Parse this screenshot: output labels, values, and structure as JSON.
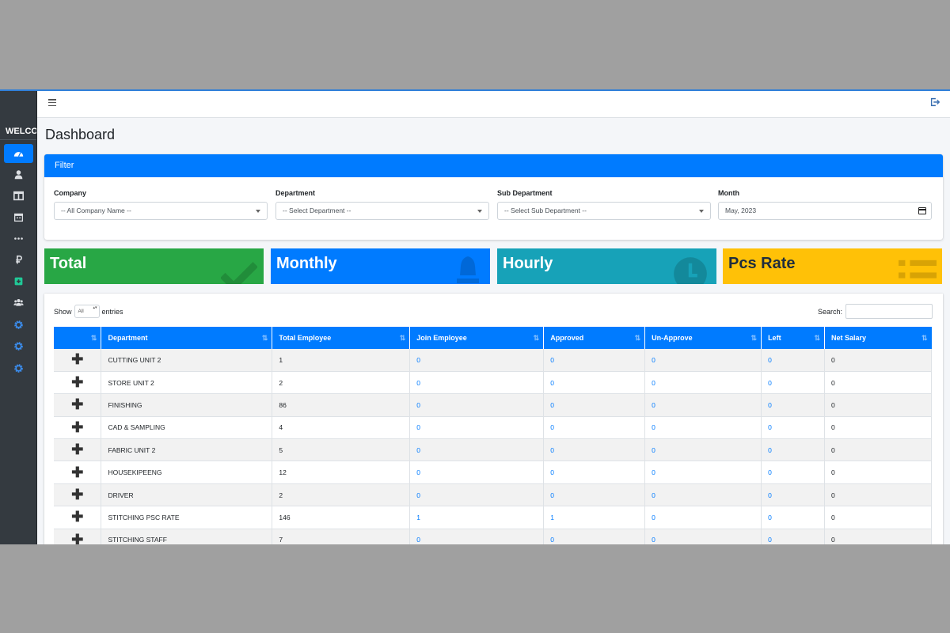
{
  "sidebar": {
    "welcome": "WELCOME",
    "icons": [
      "tachometer-icon",
      "user-icon",
      "columns-icon",
      "calendar-icon",
      "ellipsis-icon",
      "ruble-icon",
      "plus-square-icon",
      "users-icon",
      "cog-icon",
      "cog-icon",
      "cog-icon"
    ]
  },
  "page": {
    "title": "Dashboard"
  },
  "filter": {
    "header": "Filter",
    "company": {
      "label": "Company",
      "value": "-- All Company Name --"
    },
    "department": {
      "label": "Department",
      "value": "-- Select Department --"
    },
    "sub_department": {
      "label": "Sub Department",
      "value": "-- Select Sub Department --"
    },
    "month": {
      "label": "Month",
      "value": "May, 2023"
    }
  },
  "stats": [
    {
      "label": "Total",
      "color": "#28a745",
      "icon": "check-icon"
    },
    {
      "label": "Monthly",
      "color": "#007bff",
      "icon": "bell-icon"
    },
    {
      "label": "Hourly",
      "color": "#17a2b8",
      "icon": "clock-icon"
    },
    {
      "label": "Pcs Rate",
      "color": "#ffc107",
      "icon": "list-icon"
    }
  ],
  "table": {
    "show_label": "Show",
    "entries_value": "All",
    "entries_label": "entries",
    "search_label": "Search:",
    "columns": [
      "",
      "Department",
      "Total Employee",
      "Join Employee",
      "Approved",
      "Un-Approve",
      "Left",
      "Net Salary"
    ],
    "rows": [
      [
        "CUTTING UNIT 2",
        "1",
        "0",
        "0",
        "0",
        "0",
        "0"
      ],
      [
        "STORE UNIT 2",
        "2",
        "0",
        "0",
        "0",
        "0",
        "0"
      ],
      [
        "FINISHING",
        "86",
        "0",
        "0",
        "0",
        "0",
        "0"
      ],
      [
        "CAD & SAMPLING",
        "4",
        "0",
        "0",
        "0",
        "0",
        "0"
      ],
      [
        "FABRIC UNIT 2",
        "5",
        "0",
        "0",
        "0",
        "0",
        "0"
      ],
      [
        "HOUSEKIPEENG",
        "12",
        "0",
        "0",
        "0",
        "0",
        "0"
      ],
      [
        "DRIVER",
        "2",
        "0",
        "0",
        "0",
        "0",
        "0"
      ],
      [
        "STITCHING PSC RATE",
        "146",
        "1",
        "1",
        "0",
        "0",
        "0"
      ],
      [
        "STITCHING STAFF",
        "7",
        "0",
        "0",
        "0",
        "0",
        "0"
      ]
    ]
  }
}
